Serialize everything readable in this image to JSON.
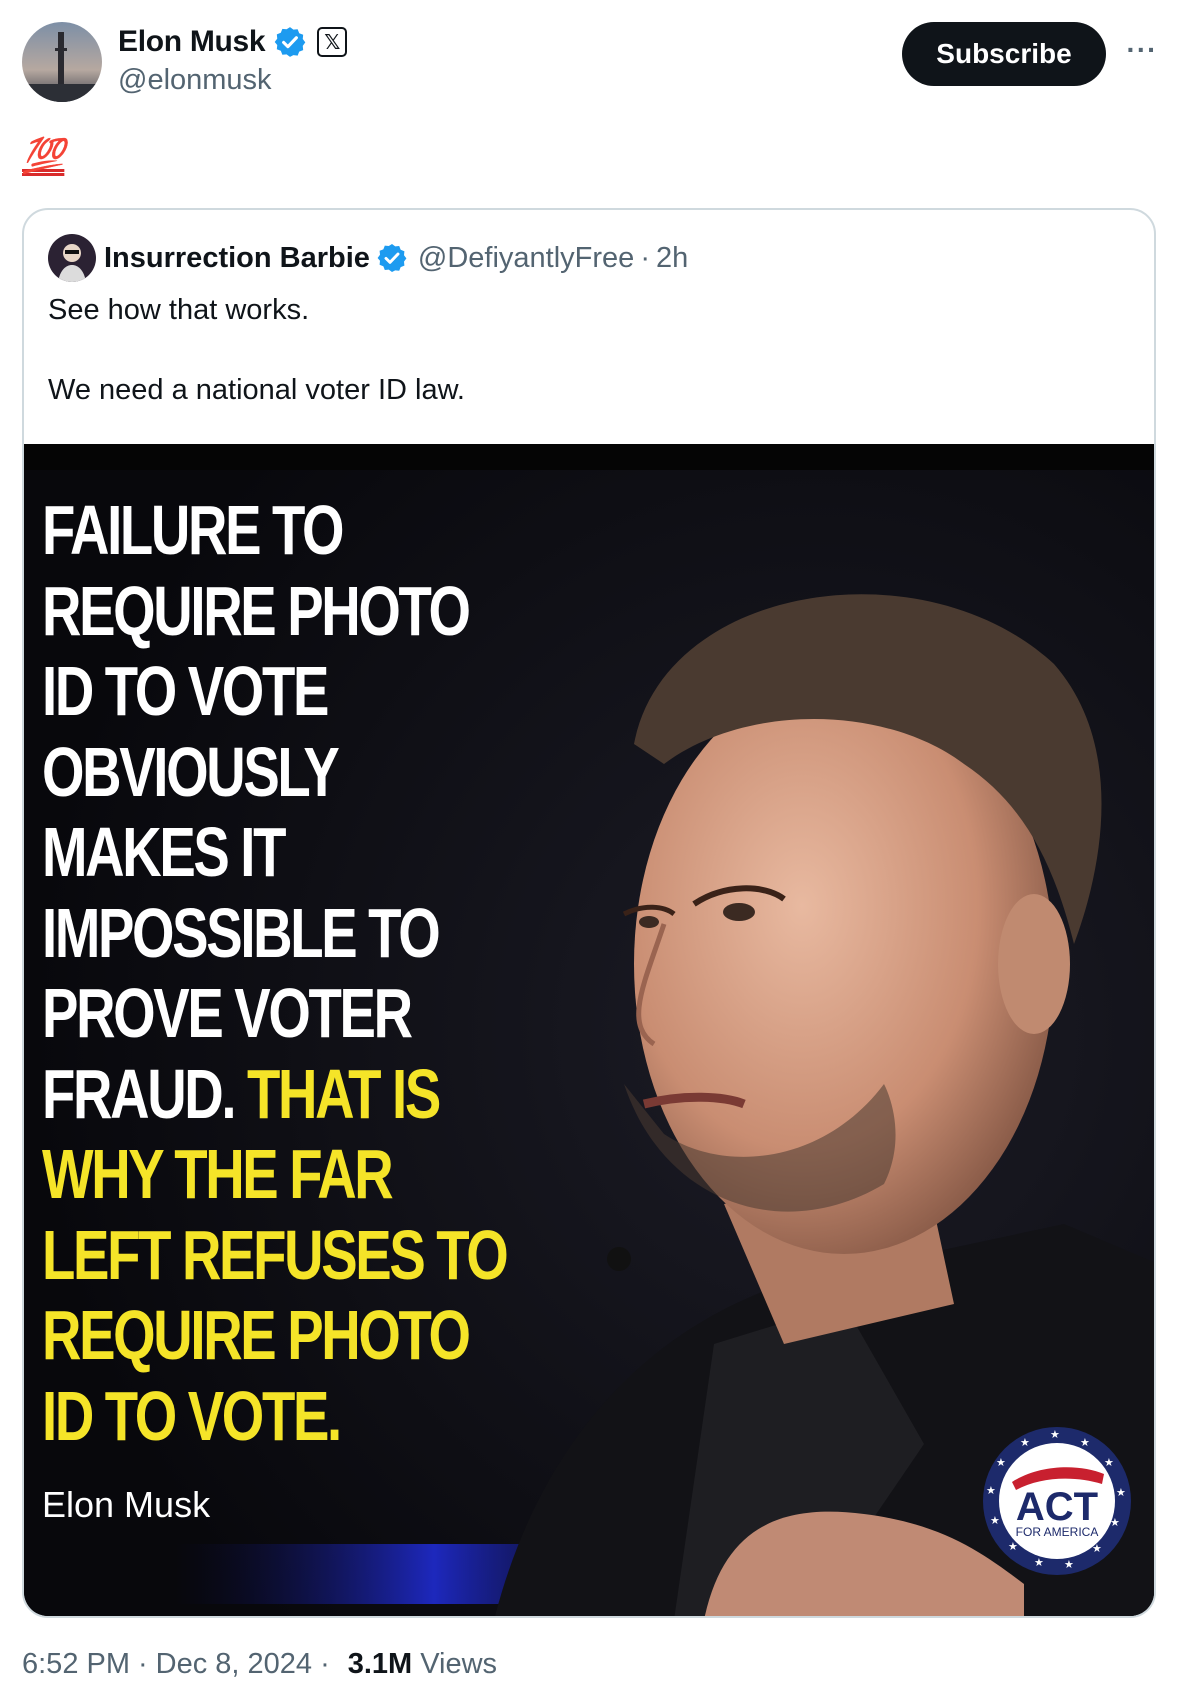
{
  "author": {
    "name": "Elon Musk",
    "handle": "@elonmusk",
    "verified_icon": "verified-badge-icon",
    "affiliate_icon": "x-logo-icon",
    "affiliate_glyph": "𝕏"
  },
  "actions": {
    "subscribe_label": "Subscribe",
    "more_label": "···"
  },
  "post": {
    "text": "💯"
  },
  "quoted_post": {
    "name": "Insurrection Barbie",
    "handle": "@DefiyantlyFree",
    "separator": "·",
    "time": "2h",
    "line1": "See how that works.",
    "line2": "We need a national voter ID law.",
    "image": {
      "lines_white": [
        "FAILURE TO",
        "REQUIRE PHOTO",
        "ID TO VOTE",
        "OBVIOUSLY",
        "MAKES IT",
        "IMPOSSIBLE TO",
        "PROVE VOTER"
      ],
      "mixed_line_white": "FRAUD.",
      "mixed_line_yellow": " THAT IS",
      "lines_yellow": [
        "WHY THE FAR",
        "LEFT REFUSES TO",
        "REQUIRE PHOTO",
        "ID TO VOTE."
      ],
      "attribution": "Elon Musk",
      "logo_text": "ACT",
      "logo_subtext": "FOR AMERICA"
    }
  },
  "footer": {
    "time": "6:52 PM",
    "date": "Dec 8, 2024",
    "views_count": "3.1M",
    "views_label": "Views",
    "separator": "·"
  },
  "colors": {
    "brand_dark": "#0f1419",
    "muted": "#536471",
    "verified": "#1d9bf0",
    "meme_yellow": "#f5e428",
    "hundred_red": "#d92b2b"
  }
}
